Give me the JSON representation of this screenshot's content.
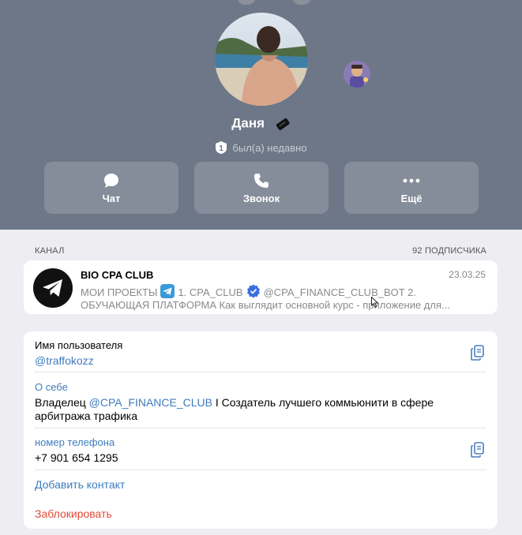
{
  "profile": {
    "name": "Даня",
    "status_badge": "1",
    "status_text": "был(а) недавно"
  },
  "actions": [
    {
      "label": "Чат",
      "icon": "chat-bubble-icon"
    },
    {
      "label": "Звонок",
      "icon": "phone-icon"
    },
    {
      "label": "Ещё",
      "icon": "more-dots-icon"
    }
  ],
  "channel_section": {
    "label": "КАНАЛ",
    "subscribers": "92 ПОДПИСЧИКА",
    "title": "BIO CPA CLUB",
    "date": "23.03.25",
    "preview_a": "МОИ ПРОЕКТЫ",
    "preview_b": "1. CPA_CLUB",
    "preview_c": "@CPA_FINANCE_CLUB_BOT   2.",
    "preview_line2": "ОБУЧАЮЩАЯ ПЛАТФОРМА  Как выглядит основной курс     - приложение для..."
  },
  "info": {
    "username_label": "Имя пользователя",
    "username": "@traffokozz",
    "bio_label": "О себе",
    "bio_prefix": "Владелец ",
    "bio_mention": "@CPA_FINANCE_CLUB",
    "bio_suffix": " I Создатель лучшего коммьюнити в сфере",
    "bio_line2": "арбитража трафика",
    "phone_label": "номер телефона",
    "phone": "+7 901 654 1295",
    "add_contact": "Добавить контакт",
    "block": "Заблокировать"
  },
  "colors": {
    "header_bg": "#6e7787",
    "action_bg": "#868d9a",
    "link": "#3e7cbf",
    "danger": "#e04a3a",
    "page_bg": "#eeeef2"
  }
}
